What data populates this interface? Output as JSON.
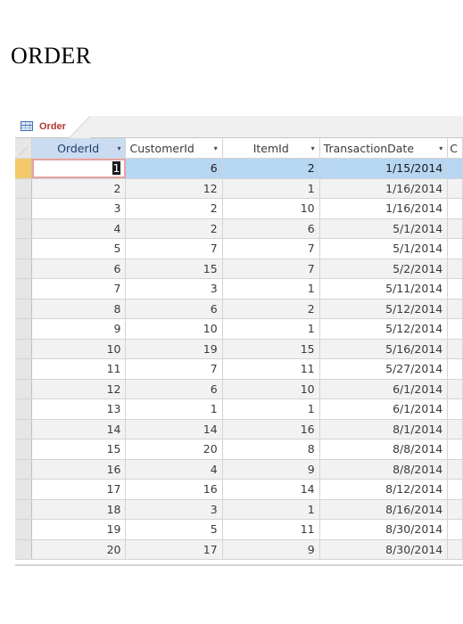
{
  "page": {
    "heading": "ORDER"
  },
  "tab": {
    "label": "Order",
    "icon": "table-icon"
  },
  "columns": [
    {
      "label": "OrderId",
      "dropdown": "▾"
    },
    {
      "label": "CustomerId",
      "dropdown": "▾"
    },
    {
      "label": "ItemId",
      "dropdown": "▾"
    },
    {
      "label": "TransactionDate",
      "dropdown": "▾"
    },
    {
      "label": "C"
    }
  ],
  "rows": [
    {
      "order_id": "1",
      "customer_id": "6",
      "item_id": "2",
      "transaction_date": "1/15/2014"
    },
    {
      "order_id": "2",
      "customer_id": "12",
      "item_id": "1",
      "transaction_date": "1/16/2014"
    },
    {
      "order_id": "3",
      "customer_id": "2",
      "item_id": "10",
      "transaction_date": "1/16/2014"
    },
    {
      "order_id": "4",
      "customer_id": "2",
      "item_id": "6",
      "transaction_date": "5/1/2014"
    },
    {
      "order_id": "5",
      "customer_id": "7",
      "item_id": "7",
      "transaction_date": "5/1/2014"
    },
    {
      "order_id": "6",
      "customer_id": "15",
      "item_id": "7",
      "transaction_date": "5/2/2014"
    },
    {
      "order_id": "7",
      "customer_id": "3",
      "item_id": "1",
      "transaction_date": "5/11/2014"
    },
    {
      "order_id": "8",
      "customer_id": "6",
      "item_id": "2",
      "transaction_date": "5/12/2014"
    },
    {
      "order_id": "9",
      "customer_id": "10",
      "item_id": "1",
      "transaction_date": "5/12/2014"
    },
    {
      "order_id": "10",
      "customer_id": "19",
      "item_id": "15",
      "transaction_date": "5/16/2014"
    },
    {
      "order_id": "11",
      "customer_id": "7",
      "item_id": "11",
      "transaction_date": "5/27/2014"
    },
    {
      "order_id": "12",
      "customer_id": "6",
      "item_id": "10",
      "transaction_date": "6/1/2014"
    },
    {
      "order_id": "13",
      "customer_id": "1",
      "item_id": "1",
      "transaction_date": "6/1/2014"
    },
    {
      "order_id": "14",
      "customer_id": "14",
      "item_id": "16",
      "transaction_date": "8/1/2014"
    },
    {
      "order_id": "15",
      "customer_id": "20",
      "item_id": "8",
      "transaction_date": "8/8/2014"
    },
    {
      "order_id": "16",
      "customer_id": "4",
      "item_id": "9",
      "transaction_date": "8/8/2014"
    },
    {
      "order_id": "17",
      "customer_id": "16",
      "item_id": "14",
      "transaction_date": "8/12/2014"
    },
    {
      "order_id": "18",
      "customer_id": "3",
      "item_id": "1",
      "transaction_date": "8/16/2014"
    },
    {
      "order_id": "19",
      "customer_id": "5",
      "item_id": "11",
      "transaction_date": "8/30/2014"
    },
    {
      "order_id": "20",
      "customer_id": "17",
      "item_id": "9",
      "transaction_date": "8/30/2014"
    }
  ],
  "colors": {
    "selected_row": "#b7d6f2",
    "selected_column_header": "#c9dcf2",
    "current_record_selector": "#f5c86a",
    "tab_label": "#b1382e"
  }
}
